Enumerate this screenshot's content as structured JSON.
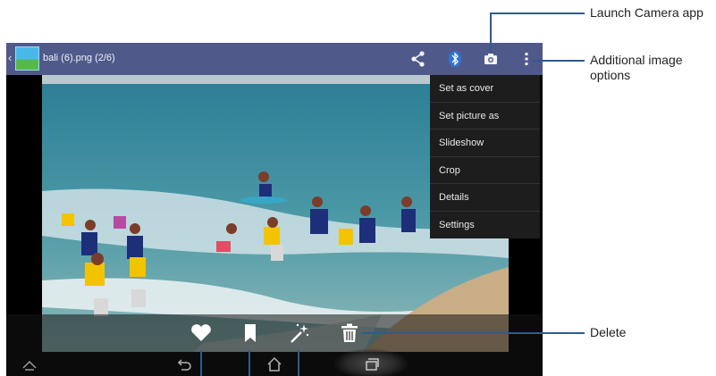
{
  "actionbar": {
    "title": "bali (6).png (2/6)",
    "color": "#4f5a8a",
    "icons": [
      "back-caret-icon",
      "app-thumbnail-icon",
      "share-icon",
      "bluetooth-icon",
      "camera-icon",
      "overflow-menu-icon"
    ]
  },
  "menu": {
    "items": [
      "Set as cover",
      "Set picture as",
      "Slideshow",
      "Crop",
      "Details",
      "Settings"
    ]
  },
  "bottom_actions": {
    "icons": [
      "favorite-heart-icon",
      "bookmark-icon",
      "magic-wand-icon",
      "delete-trash-icon"
    ]
  },
  "navbar": {
    "icons": [
      "hide-bar-icon",
      "back-icon",
      "home-icon",
      "recent-apps-icon"
    ]
  },
  "callouts": {
    "camera": "Launch Camera app",
    "options": "Additional image options",
    "delete": "Delete"
  },
  "colors": {
    "callout_line": "#2f5a92",
    "menu_bg": "#1d1d1d"
  }
}
